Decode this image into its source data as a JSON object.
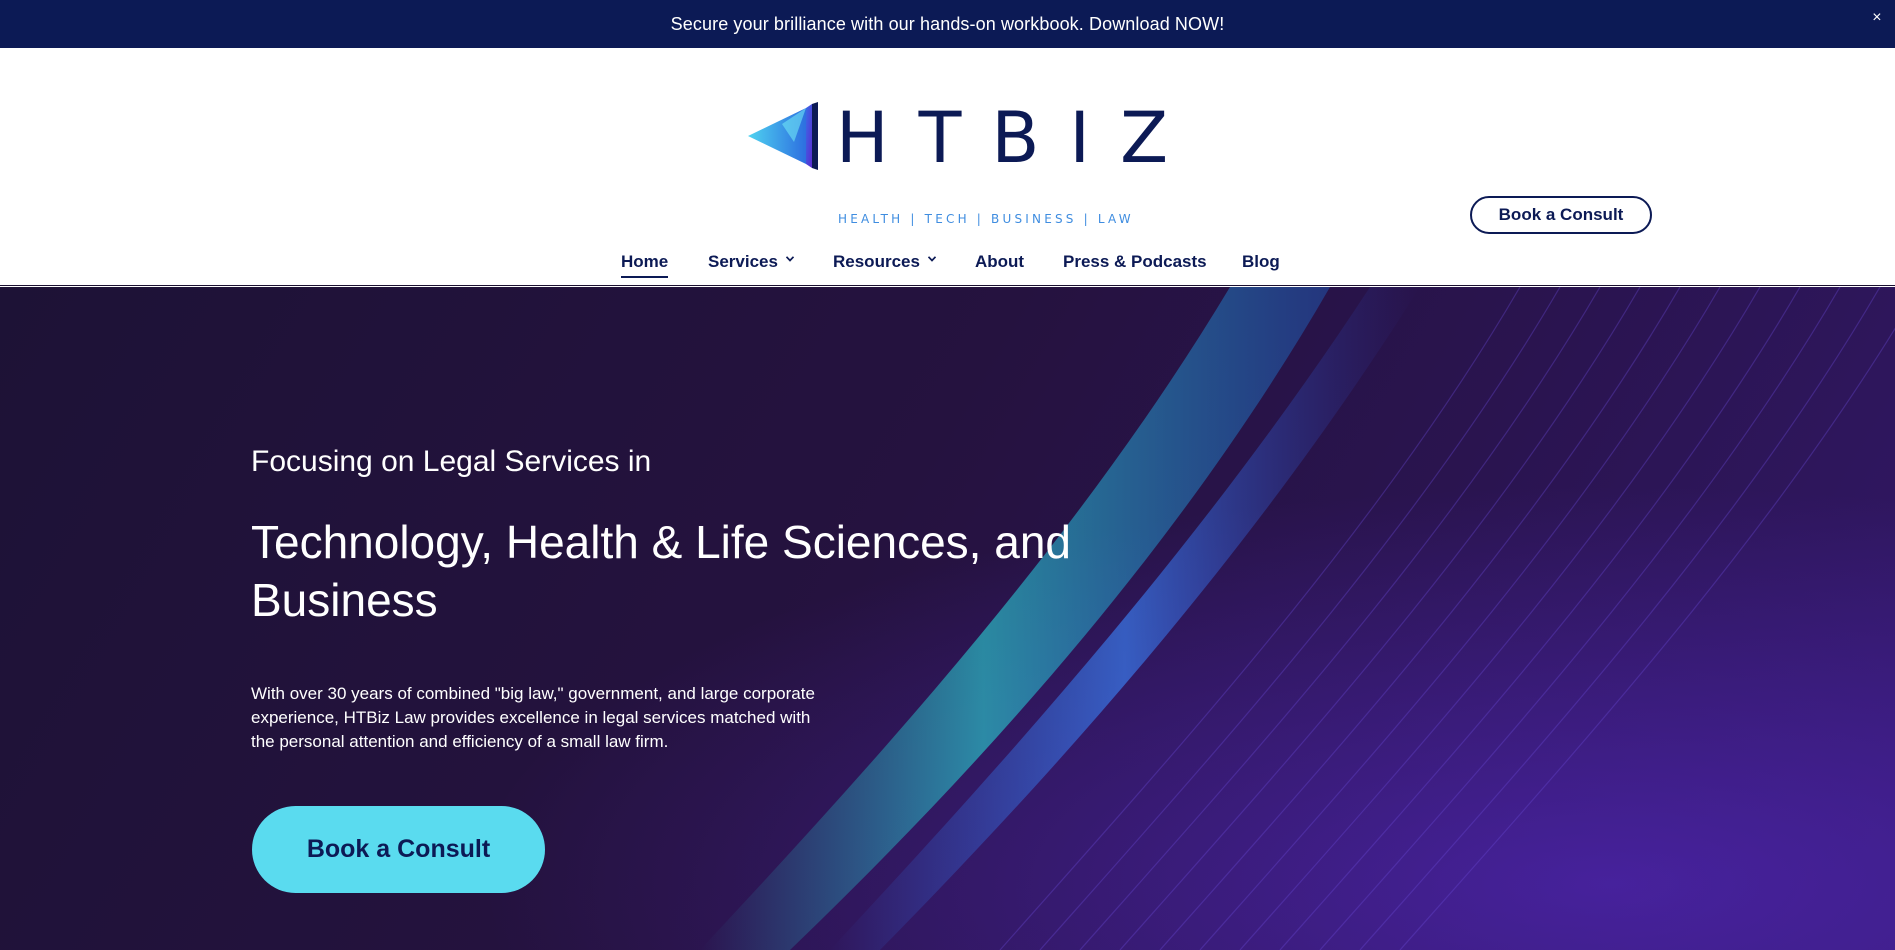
{
  "announcement": {
    "text": "Secure your brilliance with our hands-on workbook.  Download NOW!",
    "close_symbol": "×"
  },
  "brand": {
    "name": "HTBIZ",
    "tagline": "HEALTH | TECH | BUSINESS | LAW",
    "icon": "paper-plane-logo",
    "colors": {
      "navy": "#0c1a55",
      "cyan": "#5adbef",
      "blue": "#3f8de0"
    }
  },
  "header": {
    "cta_label": "Book a Consult"
  },
  "nav": {
    "items": [
      {
        "label": "Home",
        "active": true,
        "has_dropdown": false
      },
      {
        "label": "Services",
        "active": false,
        "has_dropdown": true
      },
      {
        "label": "Resources",
        "active": false,
        "has_dropdown": true
      },
      {
        "label": "About",
        "active": false,
        "has_dropdown": false
      },
      {
        "label": "Press & Podcasts",
        "active": false,
        "has_dropdown": false
      },
      {
        "label": "Blog",
        "active": false,
        "has_dropdown": false
      }
    ]
  },
  "hero": {
    "pre_title": "Focusing on Legal Services in",
    "title": "Technology, Health & Life Sciences, and Business",
    "body": "With over 30 years of combined \"big law,\" government, and large corporate experience, HTBiz Law provides excellence in legal services matched with the personal attention and efficiency of a small law firm.",
    "cta_label": "Book a Consult",
    "background_colors": [
      "#1d1236",
      "#321868",
      "#2ac1c8",
      "#3a5fe0"
    ]
  }
}
